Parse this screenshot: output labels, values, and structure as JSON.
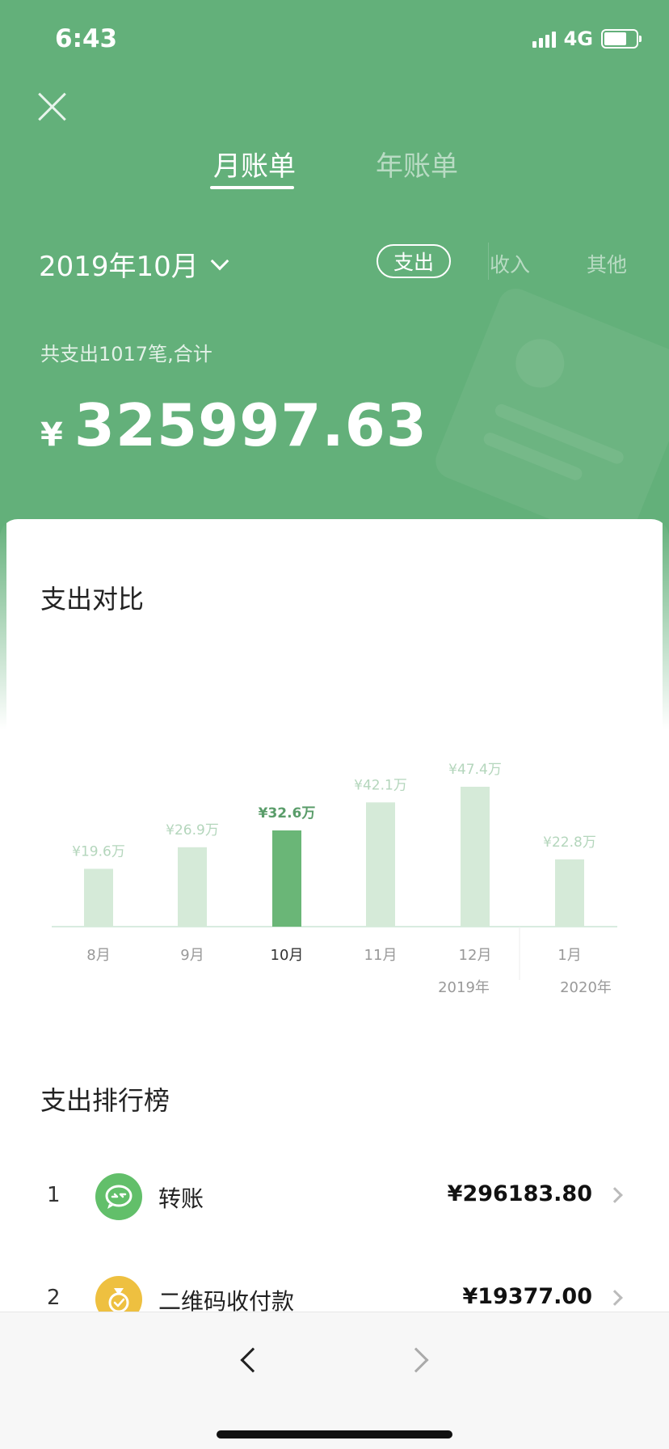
{
  "status": {
    "time": "6:43",
    "network": "4G"
  },
  "tabs": [
    {
      "label": "月账单"
    },
    {
      "label": "年账单"
    }
  ],
  "date_picker": {
    "label": "2019年10月"
  },
  "filters": [
    {
      "label": "支出"
    },
    {
      "label": "收入"
    },
    {
      "label": "其他"
    }
  ],
  "summary": {
    "label": "共支出1017笔,合计",
    "currency": "¥",
    "amount": "325997.63"
  },
  "comparison": {
    "title": "支出对比"
  },
  "chart_data": {
    "type": "bar",
    "categories": [
      "8月",
      "9月",
      "10月",
      "11月",
      "12月",
      "1月"
    ],
    "values": [
      19.6,
      26.9,
      32.6,
      42.1,
      47.4,
      22.8
    ],
    "data_labels": [
      "¥19.6万",
      "¥26.9万",
      "¥32.6万",
      "¥42.1万",
      "¥47.4万",
      "¥22.8万"
    ],
    "year_labels": [
      "2019年",
      "2020年"
    ],
    "highlight_index": 2,
    "colors": {
      "bar": "#d5ead8",
      "highlight": "#6ab677",
      "label": "#b4d6bc",
      "highlight_label": "#5a9d6a",
      "axis": "#d8ece0"
    }
  },
  "ranking": {
    "title": "支出排行榜",
    "items": [
      {
        "rank": "1",
        "name": "转账",
        "amount": "¥296183.80",
        "icon": "transfer-icon",
        "color": "#62bf6a"
      },
      {
        "rank": "2",
        "name": "二维码收付款",
        "amount": "¥19377.00",
        "icon": "money-bag-icon",
        "color": "#eec040"
      }
    ]
  }
}
